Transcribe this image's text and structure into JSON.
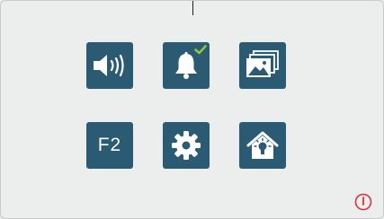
{
  "screen": {
    "background": "#eceded"
  },
  "menu": {
    "tile_color": "#2b5a73",
    "accent_color": "#8cc63f",
    "items": [
      {
        "name": "volume",
        "icon": "speaker-icon",
        "label": ""
      },
      {
        "name": "chime",
        "icon": "bell-icon",
        "label": "",
        "selected": true
      },
      {
        "name": "gallery",
        "icon": "gallery-icon",
        "label": ""
      },
      {
        "name": "f2",
        "icon": "",
        "label": "F2"
      },
      {
        "name": "settings",
        "icon": "gear-icon",
        "label": ""
      },
      {
        "name": "home-light",
        "icon": "home-light-icon",
        "label": ""
      }
    ]
  },
  "power": {
    "icon": "power-icon",
    "color": "#d9323a"
  }
}
